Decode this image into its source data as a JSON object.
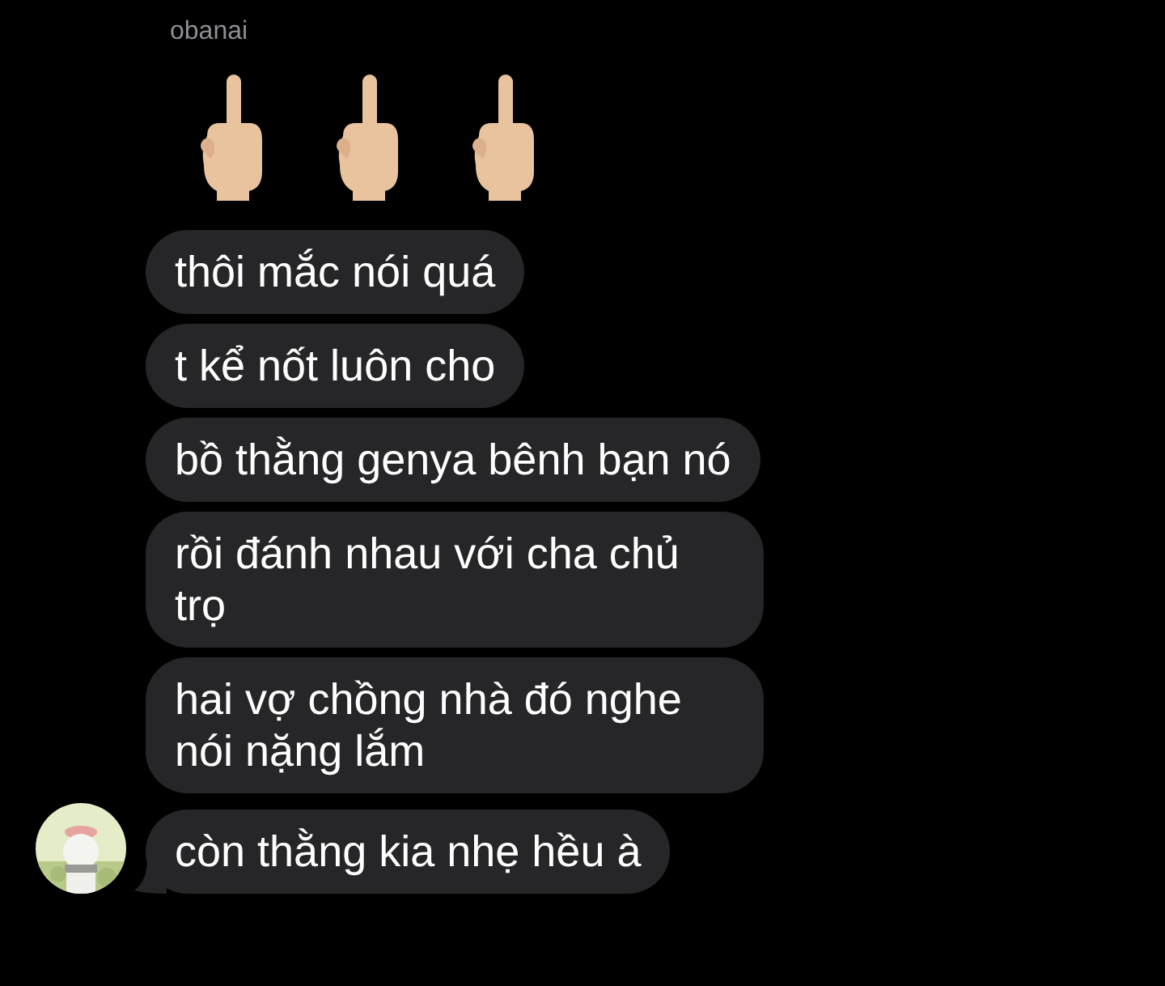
{
  "sender": "obanai",
  "messages": [
    {
      "kind": "emoji",
      "emojis": [
        {
          "kind": "hand"
        },
        {
          "kind": "hand"
        },
        {
          "kind": "hand"
        }
      ]
    },
    {
      "kind": "text",
      "text": "thôi mắc nói quá",
      "tail": false
    },
    {
      "kind": "text",
      "text": "t kể nốt luôn cho",
      "tail": false
    },
    {
      "kind": "text",
      "text": "bồ thằng genya bênh bạn nó",
      "tail": false
    },
    {
      "kind": "text",
      "text": "rồi đánh nhau với cha chủ trọ",
      "tail": false
    },
    {
      "kind": "text",
      "text": "hai vợ chồng nhà đó nghe nói nặng lắm",
      "tail": false
    },
    {
      "kind": "text",
      "text": "còn thằng kia nhẹ hều à",
      "tail": true
    }
  ]
}
